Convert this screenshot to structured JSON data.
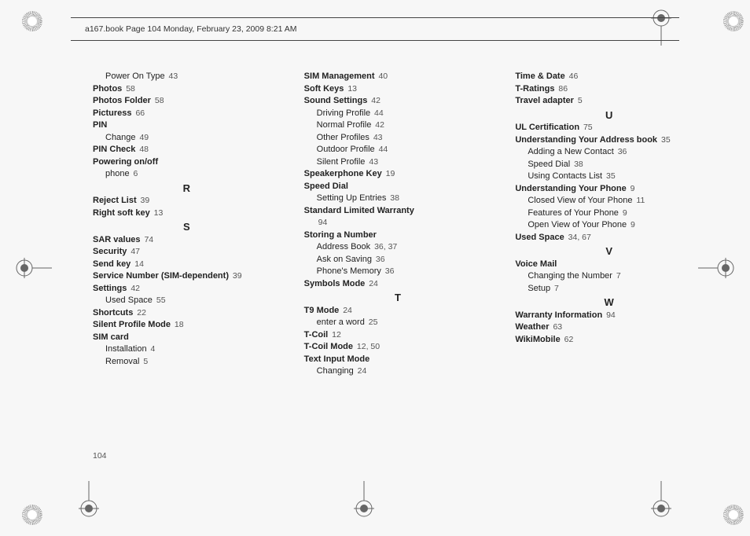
{
  "header": "a167.book  Page 104  Monday, February 23, 2009  8:21 AM",
  "page_number": "104",
  "columns": [
    [
      {
        "t": "sub",
        "label": "Power On Type",
        "pg": "43"
      },
      {
        "t": "head",
        "label": "Photos",
        "pg": "58"
      },
      {
        "t": "head",
        "label": "Photos Folder",
        "pg": "58"
      },
      {
        "t": "head",
        "label": "Picturess",
        "pg": "66"
      },
      {
        "t": "head",
        "label": "PIN",
        "pg": ""
      },
      {
        "t": "sub",
        "label": "Change",
        "pg": "49"
      },
      {
        "t": "head",
        "label": "PIN Check",
        "pg": "48"
      },
      {
        "t": "head",
        "label": "Powering on/off",
        "pg": ""
      },
      {
        "t": "sub",
        "label": "phone",
        "pg": "6"
      },
      {
        "t": "letter",
        "label": "R"
      },
      {
        "t": "head",
        "label": "Reject List",
        "pg": "39"
      },
      {
        "t": "head",
        "label": "Right soft key",
        "pg": "13"
      },
      {
        "t": "letter",
        "label": "S"
      },
      {
        "t": "head",
        "label": "SAR values",
        "pg": "74"
      },
      {
        "t": "head",
        "label": "Security",
        "pg": "47"
      },
      {
        "t": "head",
        "label": "Send key",
        "pg": "14"
      },
      {
        "t": "head",
        "label": "Service Number (SIM-dependent)",
        "pg": "39"
      },
      {
        "t": "head",
        "label": "Settings",
        "pg": "42"
      },
      {
        "t": "sub",
        "label": "Used Space",
        "pg": "55"
      },
      {
        "t": "head",
        "label": "Shortcuts",
        "pg": "22"
      },
      {
        "t": "head",
        "label": "Silent Profile Mode",
        "pg": "18"
      },
      {
        "t": "head",
        "label": "SIM card",
        "pg": ""
      },
      {
        "t": "sub",
        "label": "Installation",
        "pg": "4"
      },
      {
        "t": "sub",
        "label": "Removal",
        "pg": "5"
      }
    ],
    [
      {
        "t": "head",
        "label": "SIM Management",
        "pg": "40"
      },
      {
        "t": "head",
        "label": "Soft Keys",
        "pg": "13"
      },
      {
        "t": "head",
        "label": "Sound Settings",
        "pg": "42"
      },
      {
        "t": "sub",
        "label": "Driving Profile",
        "pg": "44"
      },
      {
        "t": "sub",
        "label": "Normal Profile",
        "pg": "42"
      },
      {
        "t": "sub",
        "label": "Other Profiles",
        "pg": "43"
      },
      {
        "t": "sub",
        "label": "Outdoor Profile",
        "pg": "44"
      },
      {
        "t": "sub",
        "label": "Silent Profile",
        "pg": "43"
      },
      {
        "t": "head",
        "label": "Speakerphone Key",
        "pg": "19"
      },
      {
        "t": "head",
        "label": "Speed Dial",
        "pg": ""
      },
      {
        "t": "sub",
        "label": "Setting Up Entries",
        "pg": "38"
      },
      {
        "t": "head",
        "label": "Standard Limited Warranty",
        "pg": ""
      },
      {
        "t": "subonly",
        "label": "94"
      },
      {
        "t": "head",
        "label": "Storing a Number",
        "pg": ""
      },
      {
        "t": "sub",
        "label": "Address Book",
        "pg": "36, 37"
      },
      {
        "t": "sub",
        "label": "Ask on Saving",
        "pg": "36"
      },
      {
        "t": "sub",
        "label": "Phone's Memory",
        "pg": "36"
      },
      {
        "t": "head",
        "label": "Symbols Mode",
        "pg": "24"
      },
      {
        "t": "letter",
        "label": "T"
      },
      {
        "t": "head",
        "label": "T9 Mode",
        "pg": "24"
      },
      {
        "t": "sub",
        "label": "enter a word",
        "pg": "25"
      },
      {
        "t": "head",
        "label": "T-Coil",
        "pg": "12"
      },
      {
        "t": "head",
        "label": "T-Coil Mode",
        "pg": "12, 50"
      },
      {
        "t": "head",
        "label": "Text Input Mode",
        "pg": ""
      },
      {
        "t": "sub",
        "label": "Changing",
        "pg": "24"
      }
    ],
    [
      {
        "t": "head",
        "label": "Time & Date",
        "pg": "46"
      },
      {
        "t": "head",
        "label": "T-Ratings",
        "pg": "86"
      },
      {
        "t": "head",
        "label": "Travel adapter",
        "pg": "5"
      },
      {
        "t": "letter",
        "label": "U"
      },
      {
        "t": "head",
        "label": "UL Certification",
        "pg": "75"
      },
      {
        "t": "head",
        "label": "Understanding Your Address book",
        "pg": "35"
      },
      {
        "t": "sub",
        "label": "Adding a New Contact",
        "pg": "36"
      },
      {
        "t": "sub",
        "label": "Speed Dial",
        "pg": "38"
      },
      {
        "t": "sub",
        "label": "Using Contacts List",
        "pg": "35"
      },
      {
        "t": "head",
        "label": "Understanding Your Phone",
        "pg": "9"
      },
      {
        "t": "sub",
        "label": "Closed View of Your Phone",
        "pg": "11"
      },
      {
        "t": "sub",
        "label": "Features of Your Phone",
        "pg": "9"
      },
      {
        "t": "sub",
        "label": "Open View of Your Phone",
        "pg": "9"
      },
      {
        "t": "head",
        "label": "Used Space",
        "pg": "34, 67"
      },
      {
        "t": "letter",
        "label": "V"
      },
      {
        "t": "head",
        "label": "Voice Mail",
        "pg": ""
      },
      {
        "t": "sub",
        "label": "Changing the Number",
        "pg": "7"
      },
      {
        "t": "sub",
        "label": "Setup",
        "pg": "7"
      },
      {
        "t": "letter",
        "label": "W"
      },
      {
        "t": "head",
        "label": "Warranty Information",
        "pg": "94"
      },
      {
        "t": "head",
        "label": "Weather",
        "pg": "63"
      },
      {
        "t": "head",
        "label": "WikiMobile",
        "pg": "62"
      }
    ]
  ]
}
